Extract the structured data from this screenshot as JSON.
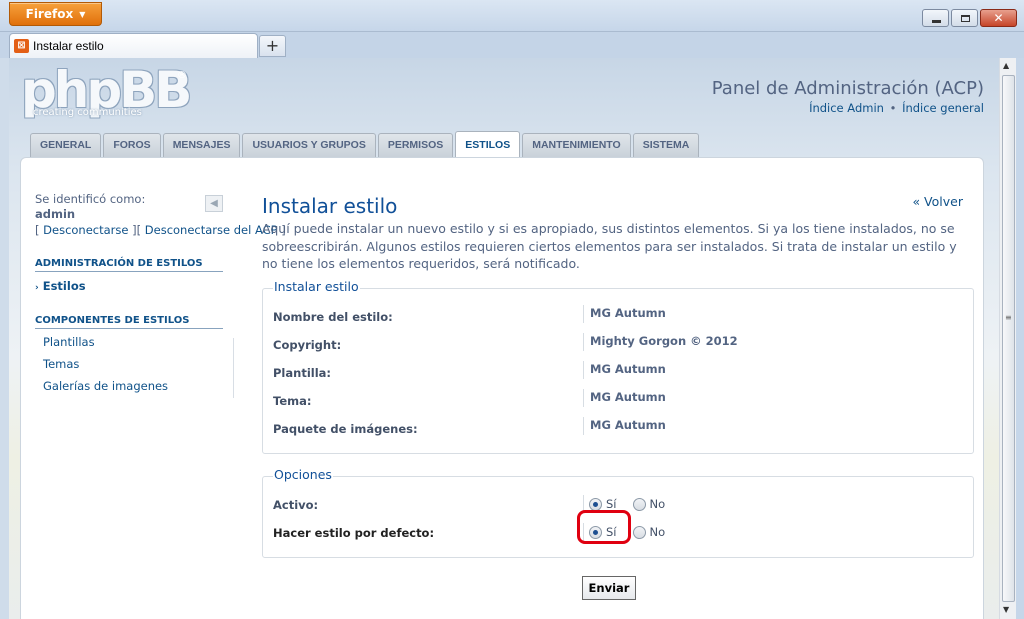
{
  "browser": {
    "app_button": "Firefox",
    "tab_title": "Instalar estilo",
    "new_tab": "+"
  },
  "header": {
    "logo": "phpBB",
    "logo_tagline": "creating communities",
    "acp_title": "Panel de Administración (ACP)",
    "link_admin_index": "Índice Admin",
    "link_separator": "•",
    "link_general_index": "Índice general"
  },
  "nav": {
    "tabs": [
      {
        "label": "GENERAL",
        "active": false
      },
      {
        "label": "FOROS",
        "active": false
      },
      {
        "label": "MENSAJES",
        "active": false
      },
      {
        "label": "USUARIOS Y GRUPOS",
        "active": false
      },
      {
        "label": "PERMISOS",
        "active": false
      },
      {
        "label": "ESTILOS",
        "active": true
      },
      {
        "label": "MANTENIMIENTO",
        "active": false
      },
      {
        "label": "SISTEMA",
        "active": false
      }
    ]
  },
  "sidebar": {
    "identified_as": "Se identificó como:",
    "username": "admin",
    "logout": "Desconectarse",
    "logout_acp": "Desconectarse del ACP",
    "section1": "ADMINISTRACIÓN DE ESTILOS",
    "item_styles": "Estilos",
    "section2": "COMPONENTES DE ESTILOS",
    "item_templates": "Plantillas",
    "item_themes": "Temas",
    "item_imagesets": "Galerías de imagenes"
  },
  "main": {
    "title": "Instalar estilo",
    "back_link": "« Volver",
    "intro": "Aquí puede instalar un nuevo estilo y si es apropiado, sus distintos elementos. Si ya los tiene instalados, no se sobreescribirán. Algunos estilos requieren ciertos elementos para ser instalados. Si trata de instalar un estilo y no tiene los elementos requeridos, será notificado.",
    "install_legend": "Instalar estilo",
    "install_rows": [
      {
        "label": "Nombre del estilo:",
        "value": "MG Autumn"
      },
      {
        "label": "Copyright:",
        "value": "Mighty Gorgon © 2012"
      },
      {
        "label": "Plantilla:",
        "value": "MG Autumn"
      },
      {
        "label": "Tema:",
        "value": "MG Autumn"
      },
      {
        "label": "Paquete de imágenes:",
        "value": "MG Autumn"
      }
    ],
    "options_legend": "Opciones",
    "active_label": "Activo:",
    "default_label": "Hacer estilo por defecto:",
    "yes": "Sí",
    "no": "No",
    "active_value": "Sí",
    "default_value": "Sí",
    "submit": "Enviar"
  },
  "colors": {
    "link": "#105289",
    "title": "#115098",
    "highlight": "#e00010",
    "firefox_orange": "#e0700b"
  }
}
